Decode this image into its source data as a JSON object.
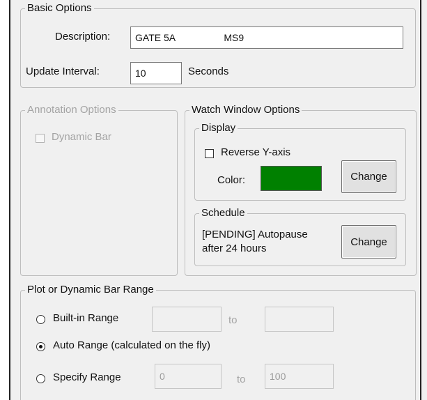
{
  "basic_options": {
    "legend": "Basic Options",
    "description_label": "Description:",
    "description_value": "GATE 5A                  MS9",
    "update_interval_label": "Update Interval:",
    "update_interval_value": "10",
    "update_interval_unit": "Seconds"
  },
  "annotation_options": {
    "legend": "Annotation Options",
    "dynamic_bar_label": "Dynamic Bar",
    "dynamic_bar_checked": false,
    "enabled": false
  },
  "watch_window_options": {
    "legend": "Watch Window Options",
    "display": {
      "legend": "Display",
      "reverse_y_axis_label": "Reverse Y-axis",
      "reverse_y_axis_checked": false,
      "color_label": "Color:",
      "color_value": "#008000",
      "change_label": "Change"
    },
    "schedule": {
      "legend": "Schedule",
      "status_line1": "[PENDING] Autopause",
      "status_line2": "after 24 hours",
      "change_label": "Change"
    }
  },
  "plot_range": {
    "legend": "Plot or Dynamic Bar Range",
    "builtin_label": "Built-in Range",
    "builtin_from": "",
    "builtin_to_label": "to",
    "builtin_to": "",
    "auto_label": "Auto Range (calculated on the fly)",
    "specify_label": "Specify Range",
    "specify_from": "0",
    "specify_to_label": "to",
    "specify_to": "100",
    "selected": "auto"
  }
}
